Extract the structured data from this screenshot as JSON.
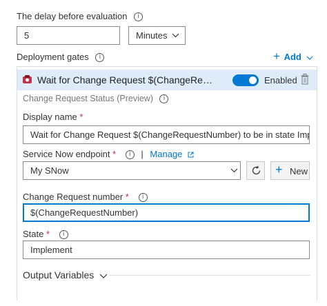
{
  "delay": {
    "label": "The delay before evaluation",
    "value": "5",
    "unit": "Minutes"
  },
  "gates": {
    "label": "Deployment gates",
    "add_label": "Add"
  },
  "gate": {
    "title": "Wait for Change Request $(ChangeRe…",
    "enabled_label": "Enabled",
    "subtitle": "Change Request Status (Preview)",
    "display_name_label": "Display name",
    "display_name_value": "Wait for Change Request $(ChangeRequestNumber) to be in state Implement",
    "endpoint_label": "Service Now endpoint",
    "manage_label": "Manage",
    "endpoint_value": "My SNow",
    "new_label": "New",
    "cr_number_label": "Change Request number",
    "cr_number_value": "$(ChangeRequestNumber)",
    "state_label": "State",
    "state_value": "Implement",
    "output_vars_label": "Output Variables"
  },
  "colors": {
    "accent": "#0078d4",
    "header_bg": "#deecf9",
    "required": "#c4314b"
  }
}
